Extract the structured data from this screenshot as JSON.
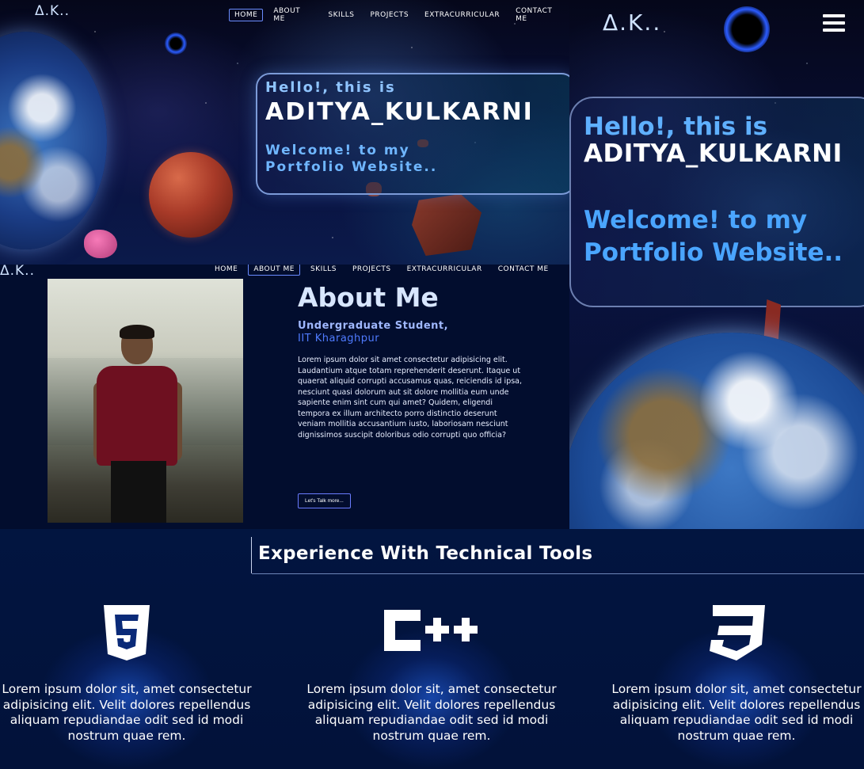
{
  "hero": {
    "logo": "Δ.K..",
    "nav": [
      "HOME",
      "ABOUT ME",
      "SKILLS",
      "PROJECTS",
      "EXTRACURRICULAR",
      "CONTACT ME"
    ],
    "greet": "Hello!, this is",
    "name": "ADITYA_KULKARNI",
    "welcome": "Welcome! to my Portfolio Website.."
  },
  "mobile": {
    "logo": "Δ.K..",
    "greet": "Hello!, this is",
    "name": "ADITYA_KULKARNI",
    "welcome": "Welcome! to my Portfolio Website.."
  },
  "about": {
    "logo": "Δ.K..",
    "nav": [
      "HOME",
      "ABOUT ME",
      "SKILLS",
      "PROJECTS",
      "EXTRACURRICULAR",
      "CONTACT ME"
    ],
    "title": "About Me",
    "role": "Undergraduate Student,",
    "school": "IIT Kharaghpur",
    "text": "Lorem ipsum dolor sit amet consectetur adipisicing elit. Laudantium atque totam reprehenderit deserunt. Itaque ut quaerat aliquid corrupti accusamus quas, reiciendis id ipsa, nesciunt quasi dolorum aut sit dolore mollitia eum unde sapiente enim sint cum qui amet? Quidem, eligendi tempora ex illum architecto porro distinctio deserunt veniam mollitia accusantium iusto, laboriosam nesciunt dignissimos suscipit doloribus odio corrupti quo officia?",
    "button": "Let's Talk more..."
  },
  "skills": {
    "title": "Experience With Technical Tools",
    "items": [
      {
        "icon": "html5-icon",
        "desc": "Lorem ipsum dolor sit, amet consectetur adipisicing elit. Velit dolores repellendus aliquam repudiandae odit sed id modi nostrum quae rem."
      },
      {
        "icon": "cpp-icon",
        "desc": "Lorem ipsum dolor sit, amet consectetur adipisicing elit. Velit dolores repellendus aliquam repudiandae odit sed id modi nostrum quae rem."
      },
      {
        "icon": "css3-icon",
        "desc": "Lorem ipsum dolor sit, amet consectetur adipisicing elit. Velit dolores repellendus aliquam repudiandae odit sed id modi nostrum quae rem."
      }
    ]
  },
  "colors": {
    "accent": "#6fb6ff",
    "nav_active_border": "#6a8cff",
    "background": "#020a2a"
  }
}
